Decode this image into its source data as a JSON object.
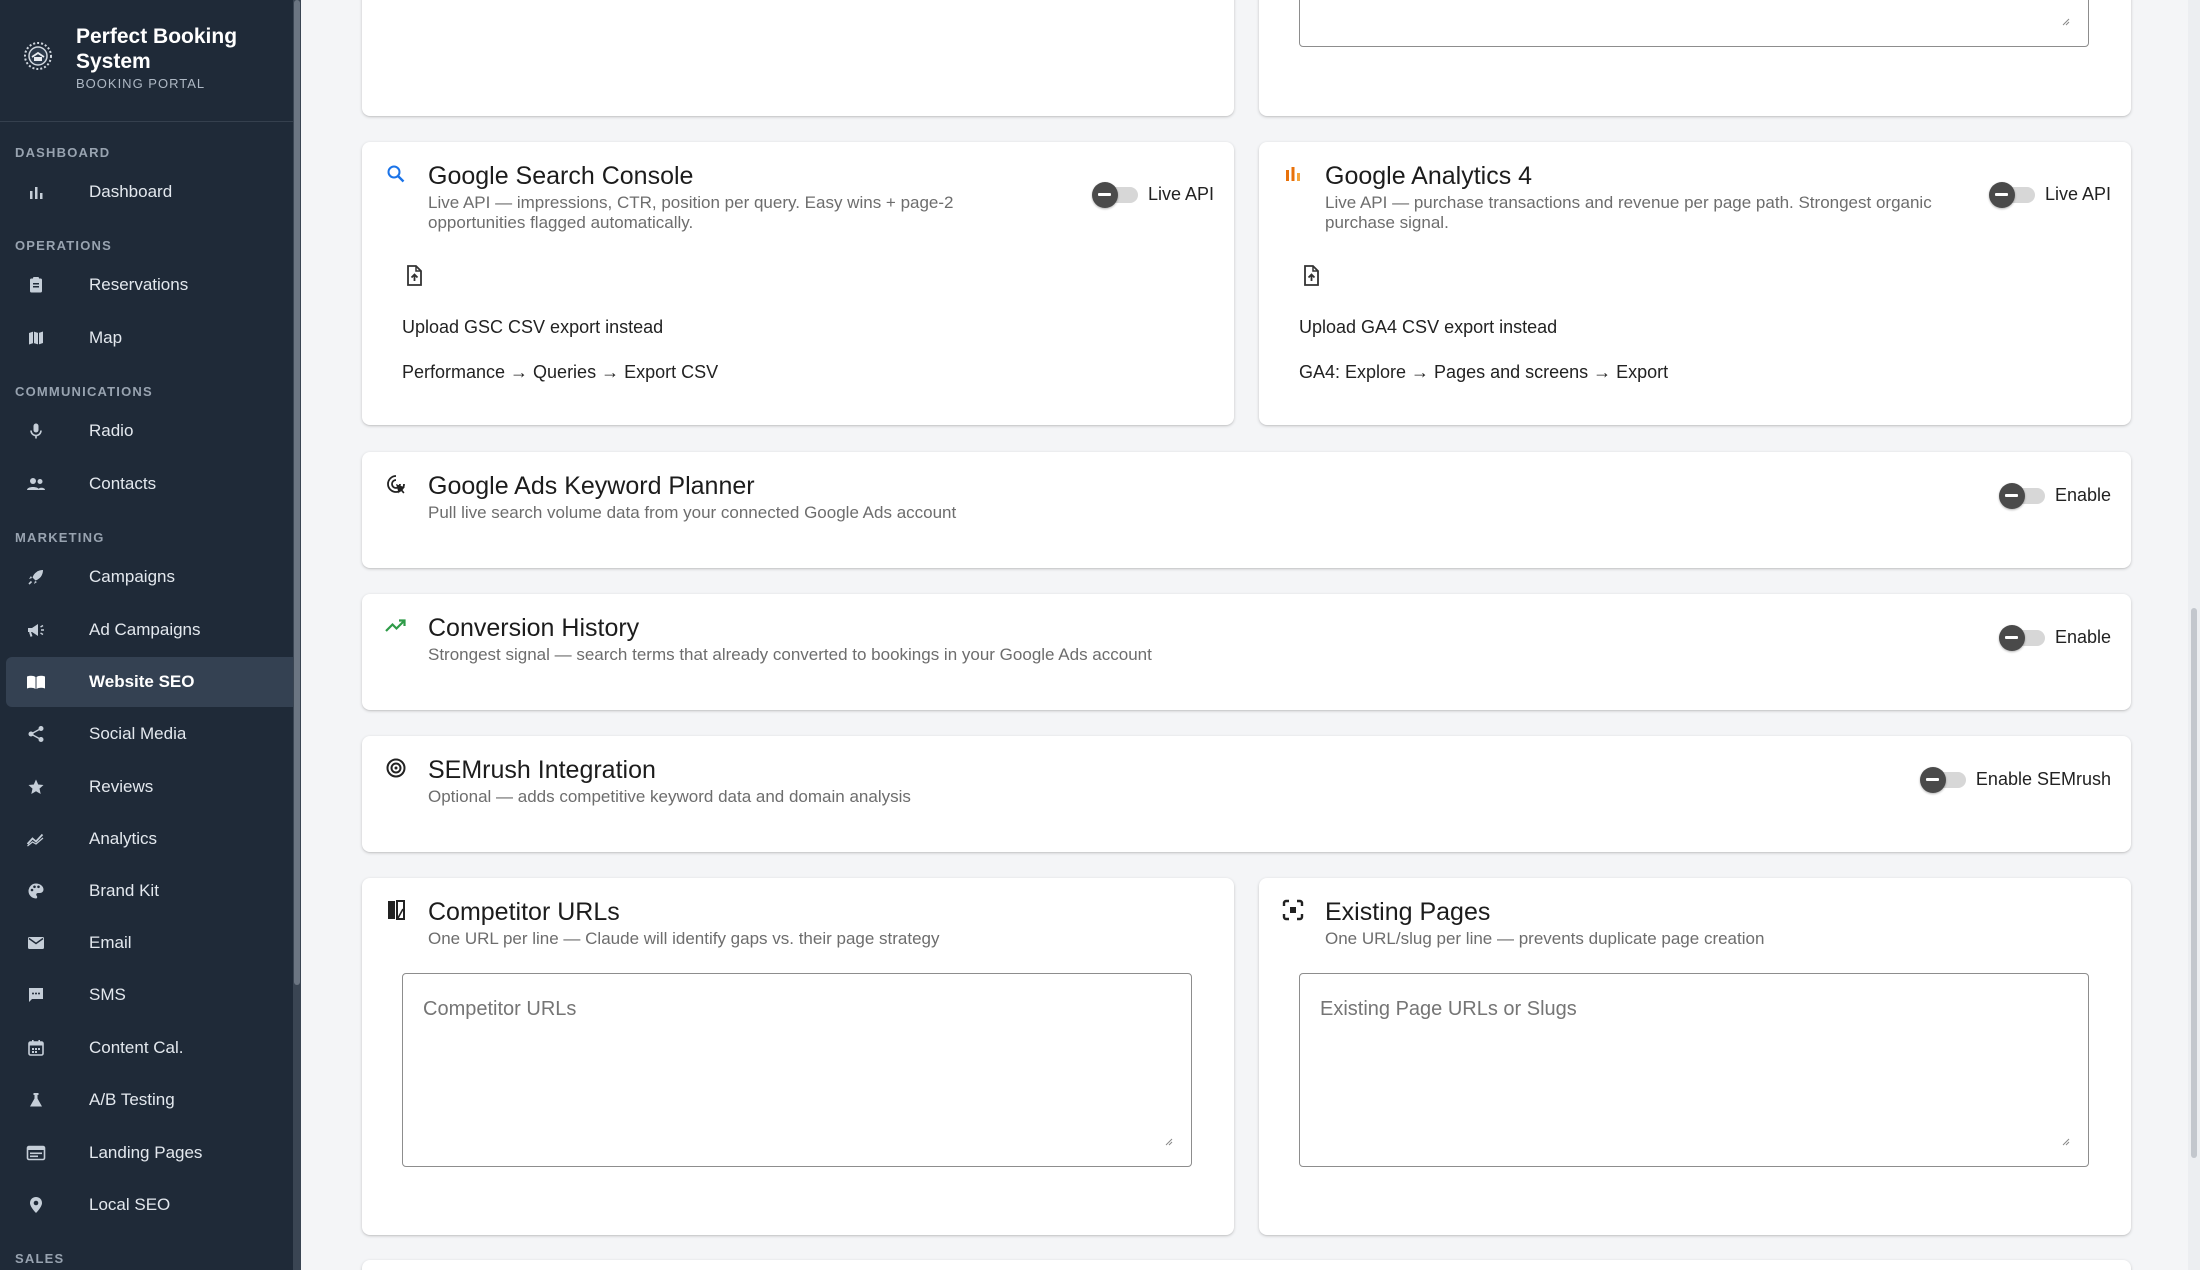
{
  "brand": {
    "name": "Perfect Booking System",
    "subtitle": "BOOKING PORTAL"
  },
  "nav": {
    "sections": {
      "dashboard": "DASHBOARD",
      "operations": "OPERATIONS",
      "communications": "COMMUNICATIONS",
      "marketing": "MARKETING",
      "sales": "SALES"
    },
    "items": {
      "dashboard": "Dashboard",
      "reservations": "Reservations",
      "map": "Map",
      "radio": "Radio",
      "contacts": "Contacts",
      "campaigns": "Campaigns",
      "ad_campaigns": "Ad Campaigns",
      "website_seo": "Website SEO",
      "social_media": "Social Media",
      "reviews": "Reviews",
      "analytics": "Analytics",
      "brand_kit": "Brand Kit",
      "email": "Email",
      "sms": "SMS",
      "content_cal": "Content Cal.",
      "ab_testing": "A/B Testing",
      "landing_pages": "Landing Pages",
      "local_seo": "Local SEO"
    },
    "active": "Website SEO"
  },
  "gsc": {
    "title": "Google Search Console",
    "description": "Live API — impressions, CTR, position per query. Easy wins + page-2 opportunities flagged automatically.",
    "toggle_label": "Live API",
    "enabled": false,
    "upload_label": "Upload GSC CSV export instead",
    "path_hint": "Performance → Queries → Export CSV"
  },
  "ga4": {
    "title": "Google Analytics 4",
    "description": "Live API — purchase transactions and revenue per page path. Strongest organic purchase signal.",
    "toggle_label": "Live API",
    "enabled": false,
    "upload_label": "Upload GA4 CSV export instead",
    "path_hint": "GA4: Explore → Pages and screens → Export"
  },
  "keyword_planner": {
    "title": "Google Ads Keyword Planner",
    "description": "Pull live search volume data from your connected Google Ads account",
    "toggle_label": "Enable",
    "enabled": false
  },
  "conversion_history": {
    "title": "Conversion History",
    "description": "Strongest signal — search terms that already converted to bookings in your Google Ads account",
    "toggle_label": "Enable",
    "enabled": false
  },
  "semrush": {
    "title": "SEMrush Integration",
    "description": "Optional — adds competitive keyword data and domain analysis",
    "toggle_label": "Enable SEMrush",
    "enabled": false
  },
  "competitors": {
    "title": "Competitor URLs",
    "description": "One URL per line — Claude will identify gaps vs. their page strategy",
    "placeholder": "Competitor URLs"
  },
  "existing_pages": {
    "title": "Existing Pages",
    "description": "One URL/slug per line — prevents duplicate page creation",
    "placeholder": "Existing Page URLs or Slugs"
  },
  "colors": {
    "sidebar_bg": "#1f2a38",
    "gsc_icon": "#1a73e8",
    "ga4_icon": "#e8710a",
    "trend_icon": "#2e9b48"
  }
}
